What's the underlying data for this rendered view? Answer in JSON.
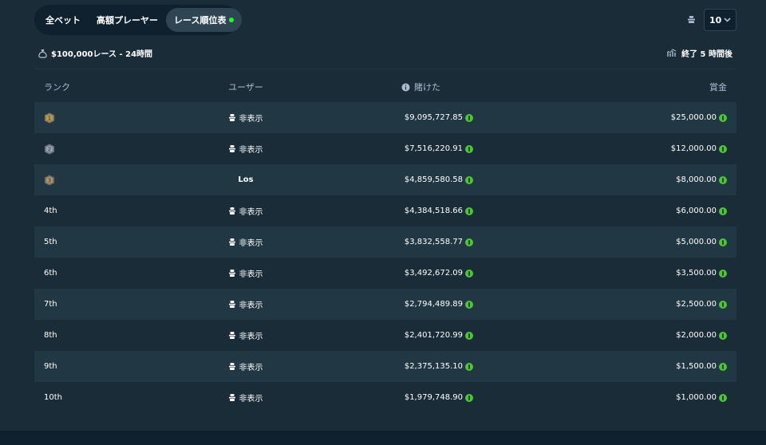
{
  "tabs": [
    {
      "label": "全ベット"
    },
    {
      "label": "高額プレーヤー"
    },
    {
      "label": "レース順位表"
    }
  ],
  "count_select": {
    "value": "10"
  },
  "race": {
    "title": "$100,000レース - 24時間",
    "ends": "終了 5 時間後"
  },
  "columns": {
    "rank": "ランク",
    "user": "ユーザー",
    "bet": "賭けた",
    "prize": "賞金"
  },
  "rows": [
    {
      "rank": "1",
      "user": "非表示",
      "bet": "$9,095,727.85",
      "prize": "$25,000.00"
    },
    {
      "rank": "2",
      "user": "非表示",
      "bet": "$7,516,220.91",
      "prize": "$12,000.00"
    },
    {
      "rank": "3",
      "user": "Los",
      "bet": "$4,859,580.58",
      "prize": "$8,000.00"
    },
    {
      "rank": "4th",
      "user": "非表示",
      "bet": "$4,384,518.66",
      "prize": "$6,000.00"
    },
    {
      "rank": "5th",
      "user": "非表示",
      "bet": "$3,832,558.77",
      "prize": "$5,000.00"
    },
    {
      "rank": "6th",
      "user": "非表示",
      "bet": "$3,492,672.09",
      "prize": "$3,500.00"
    },
    {
      "rank": "7th",
      "user": "非表示",
      "bet": "$2,794,489.89",
      "prize": "$2,500.00"
    },
    {
      "rank": "8th",
      "user": "非表示",
      "bet": "$2,401,720.99",
      "prize": "$2,000.00"
    },
    {
      "rank": "9th",
      "user": "非表示",
      "bet": "$2,375,135.10",
      "prize": "$1,500.00"
    },
    {
      "rank": "10th",
      "user": "非表示",
      "bet": "$1,979,748.90",
      "prize": "$1,000.00"
    }
  ],
  "colors": {
    "background": "#1a2c38",
    "row_alt": "#213743",
    "accent_green": "#1fff20",
    "coin": "#4fc437"
  }
}
